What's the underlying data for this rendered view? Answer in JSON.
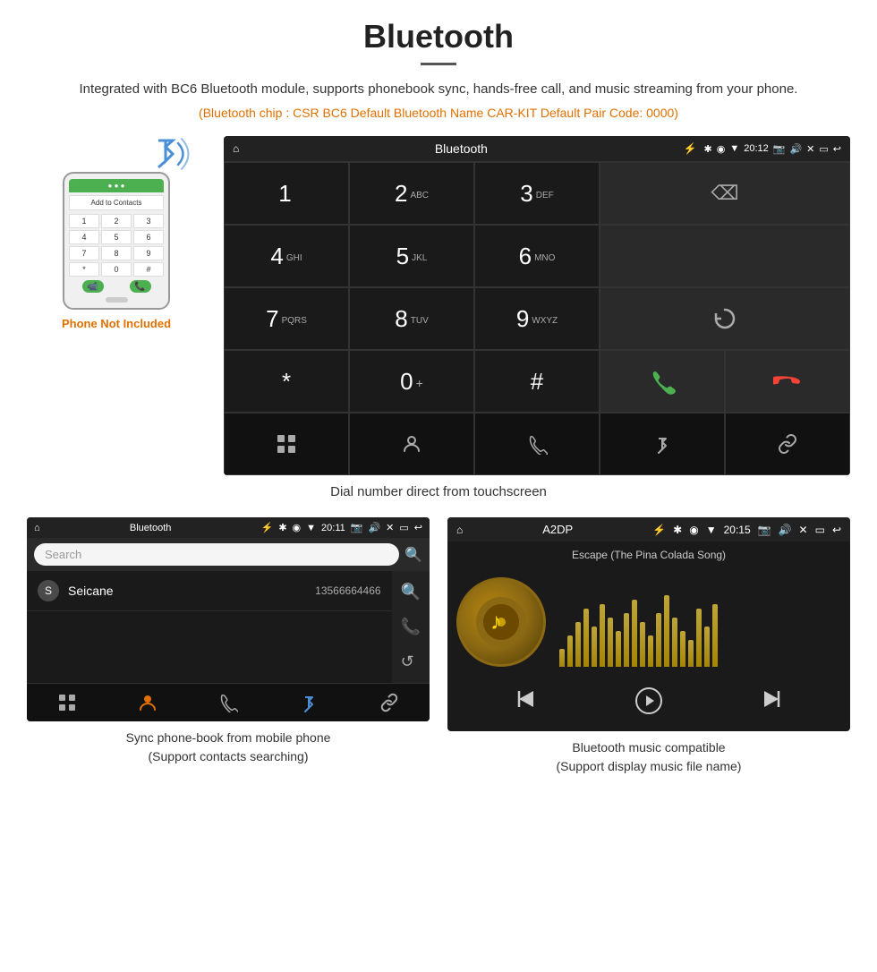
{
  "page": {
    "title": "Bluetooth",
    "subtitle": "Integrated with BC6 Bluetooth module, supports phonebook sync, hands-free call, and music streaming from your phone.",
    "specs": "(Bluetooth chip : CSR BC6    Default Bluetooth Name CAR-KIT    Default Pair Code: 0000)",
    "dial_caption": "Dial number direct from touchscreen",
    "phonebook_caption": "Sync phone-book from mobile phone\n(Support contacts searching)",
    "music_caption": "Bluetooth music compatible\n(Support display music file name)"
  },
  "phone": {
    "not_included": "Phone Not Included",
    "add_contacts_label": "Add to Contacts",
    "dialpad": [
      "1",
      "2",
      "3",
      "4",
      "5",
      "6",
      "7",
      "8",
      "9",
      "*",
      "0",
      "#"
    ]
  },
  "dial_screen": {
    "status_title": "Bluetooth",
    "time": "20:12",
    "keys": [
      {
        "num": "1",
        "sub": ""
      },
      {
        "num": "2",
        "sub": "ABC"
      },
      {
        "num": "3",
        "sub": "DEF"
      },
      {
        "num": "4",
        "sub": "GHI"
      },
      {
        "num": "5",
        "sub": "JKL"
      },
      {
        "num": "6",
        "sub": "MNO"
      },
      {
        "num": "7",
        "sub": "PQRS"
      },
      {
        "num": "8",
        "sub": "TUV"
      },
      {
        "num": "9",
        "sub": "WXYZ"
      },
      {
        "num": "*",
        "sub": ""
      },
      {
        "num": "0",
        "sub": "+"
      },
      {
        "num": "#",
        "sub": ""
      }
    ],
    "bottom_icons": [
      "grid",
      "person",
      "phone",
      "bluetooth",
      "link"
    ]
  },
  "phonebook_screen": {
    "status_title": "Bluetooth",
    "time": "20:11",
    "search_placeholder": "Search",
    "contact": {
      "letter": "S",
      "name": "Seicane",
      "phone": "13566664466"
    },
    "sidebar_icons": [
      "search",
      "phone",
      "refresh"
    ]
  },
  "music_screen": {
    "status_title": "A2DP",
    "time": "20:15",
    "song_title": "Escape (The Pina Colada Song)",
    "album_icon": "♪",
    "visualizer_heights": [
      20,
      35,
      50,
      65,
      45,
      70,
      55,
      40,
      60,
      75,
      50,
      35,
      60,
      80,
      55,
      40,
      30,
      65,
      45,
      70
    ],
    "controls": [
      "prev",
      "play-pause",
      "next"
    ]
  },
  "colors": {
    "orange": "#e07000",
    "green": "#4caf50",
    "red": "#f44336",
    "bluetooth_blue": "#4a90d9",
    "dark_bg": "#1a1a1a",
    "medium_bg": "#2a2a2a"
  }
}
